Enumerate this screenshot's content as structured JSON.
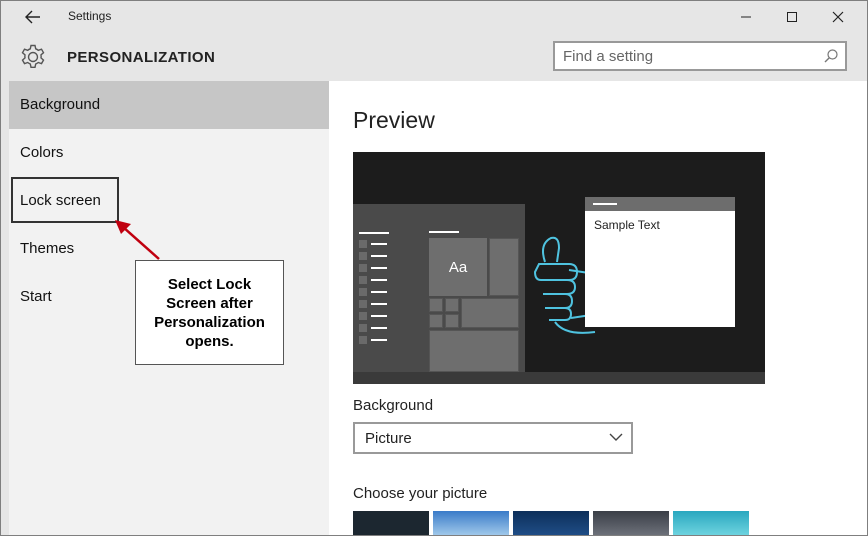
{
  "window": {
    "title": "Settings"
  },
  "header": {
    "title": "PERSONALIZATION",
    "search_placeholder": "Find a setting"
  },
  "sidebar": {
    "items": [
      {
        "label": "Background",
        "selected": true
      },
      {
        "label": "Colors",
        "selected": false
      },
      {
        "label": "Lock screen",
        "selected": false
      },
      {
        "label": "Themes",
        "selected": false
      },
      {
        "label": "Start",
        "selected": false
      }
    ]
  },
  "annotation": {
    "note": "Select Lock Screen after Personalization opens."
  },
  "main": {
    "preview_title": "Preview",
    "preview_sample_text": "Sample Text",
    "preview_tile_text": "Aa",
    "background_label": "Background",
    "background_value": "Picture",
    "choose_picture_label": "Choose your picture"
  },
  "colors": {
    "accent_sidebar_selected": "#c6c6c6",
    "annotation_arrow": "#c0000f",
    "preview_bg": "#1c1c1c",
    "thumbs": [
      "#1c2730",
      "#3a7bc8",
      "#0d2f5a",
      "#3b3f47",
      "#2aa7bf"
    ]
  }
}
